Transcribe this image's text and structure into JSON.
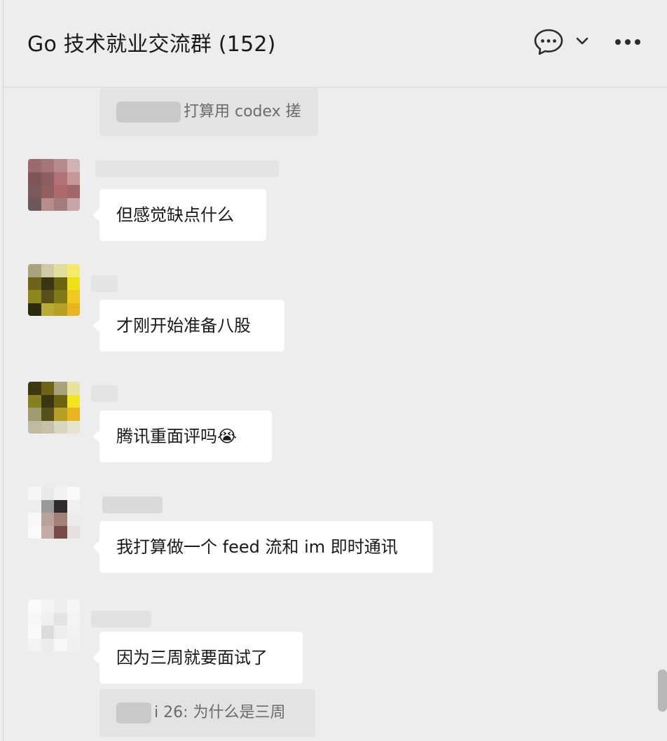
{
  "header": {
    "title": "Go 技术就业交流群 (152)",
    "icons": [
      "chat-bubble-icon",
      "chevron-down-icon",
      "more-icon"
    ]
  },
  "messages": {
    "quote1": {
      "sender_blurred": true,
      "text": "打算用 codex 搓"
    },
    "m1": {
      "text": "但感觉缺点什么"
    },
    "m2": {
      "text": "才刚开始准备八股"
    },
    "m3": {
      "text": "腾讯重面评吗😭"
    },
    "m4": {
      "text": "我打算做一个 feed 流和 im 即时通讯"
    },
    "m5": {
      "text": "因为三周就要面试了"
    },
    "quote2": {
      "sender_fragment": "i 26:",
      "text": " 为什么是三周"
    }
  }
}
